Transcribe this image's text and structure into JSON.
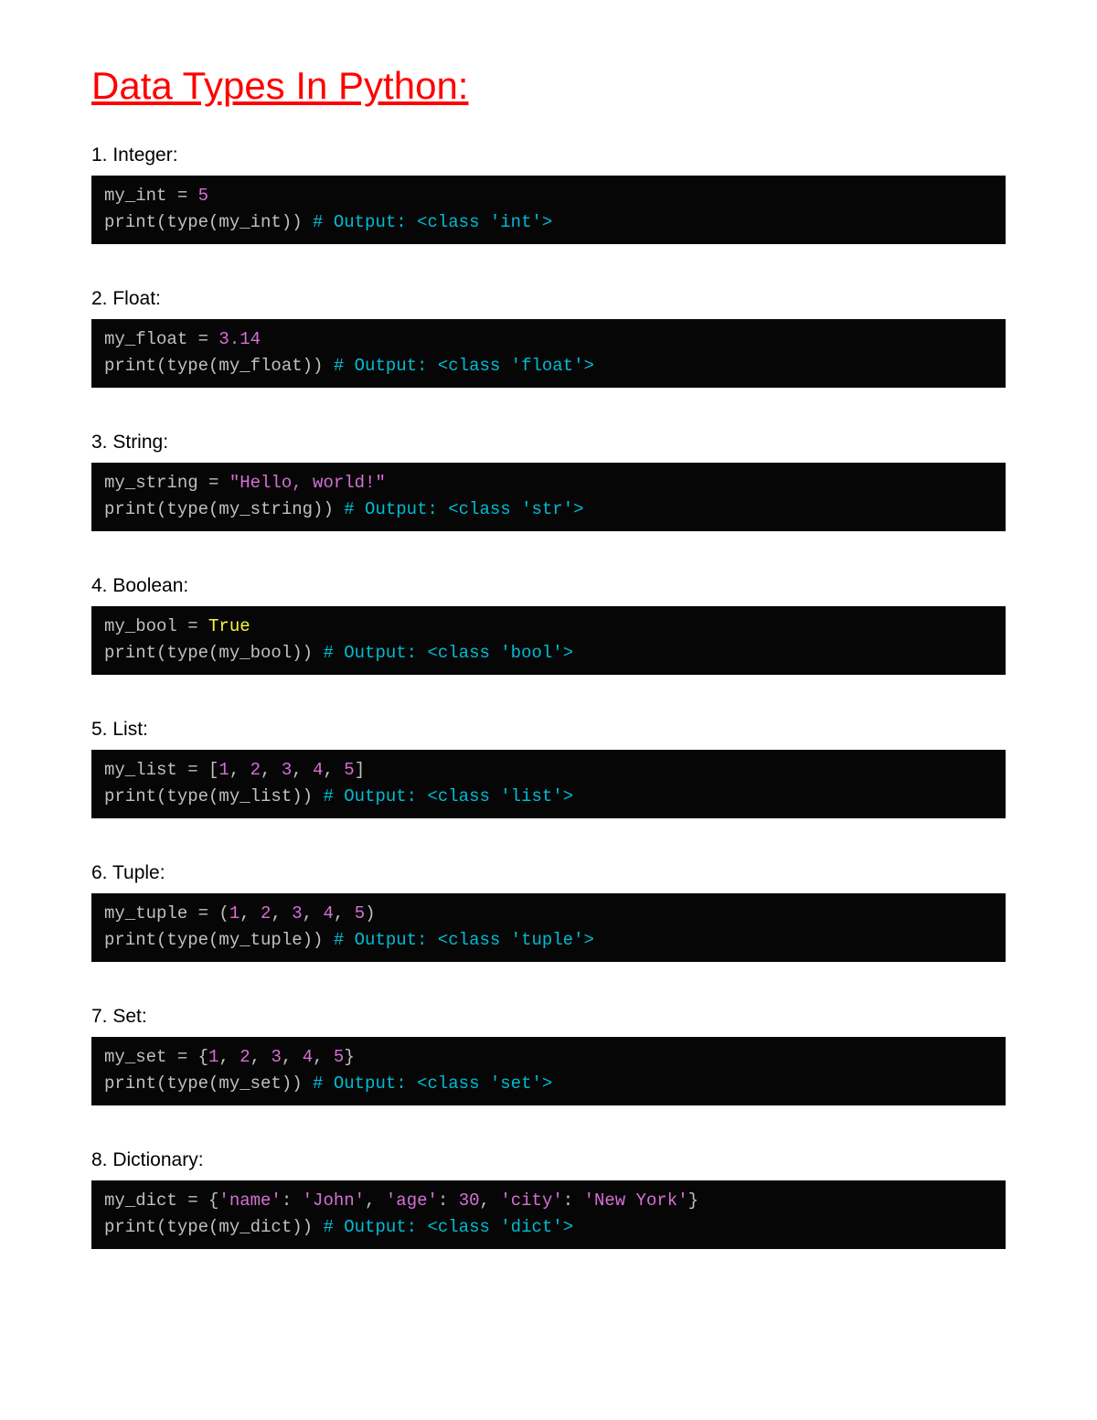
{
  "title": "Data Types In Python:",
  "sections": [
    {
      "heading": "1. Integer:",
      "code_html": "<span class=\"t-default\">my_int = </span><span class=\"t-num\">5</span>\n<span class=\"t-default\">print(type(my_int)) </span><span class=\"t-comment\"># Output: &lt;class 'int'&gt;</span>"
    },
    {
      "heading": "2. Float:",
      "code_html": "<span class=\"t-default\">my_float = </span><span class=\"t-num\">3.14</span>\n<span class=\"t-default\">print(type(my_float)) </span><span class=\"t-comment\"># Output: &lt;class 'float'&gt;</span>"
    },
    {
      "heading": "3. String:",
      "code_html": "<span class=\"t-default\">my_string = </span><span class=\"t-str\">\"Hello, world!\"</span>\n<span class=\"t-default\">print(type(my_string)) </span><span class=\"t-comment\"># Output: &lt;class 'str'&gt;</span>"
    },
    {
      "heading": "4. Boolean:",
      "code_html": "<span class=\"t-default\">my_bool = </span><span class=\"t-bool\">True</span>\n<span class=\"t-default\">print(type(my_bool)) </span><span class=\"t-comment\"># Output: &lt;class 'bool'&gt;</span>"
    },
    {
      "heading": "5. List:",
      "code_html": "<span class=\"t-default\">my_list = [</span><span class=\"t-num\">1</span><span class=\"t-default\">, </span><span class=\"t-num\">2</span><span class=\"t-default\">, </span><span class=\"t-num\">3</span><span class=\"t-default\">, </span><span class=\"t-num\">4</span><span class=\"t-default\">, </span><span class=\"t-num\">5</span><span class=\"t-default\">]</span>\n<span class=\"t-default\">print(type(my_list)) </span><span class=\"t-comment\"># Output: &lt;class 'list'&gt;</span>"
    },
    {
      "heading": "6. Tuple:",
      "code_html": "<span class=\"t-default\">my_tuple = (</span><span class=\"t-num\">1</span><span class=\"t-default\">, </span><span class=\"t-num\">2</span><span class=\"t-default\">, </span><span class=\"t-num\">3</span><span class=\"t-default\">, </span><span class=\"t-num\">4</span><span class=\"t-default\">, </span><span class=\"t-num\">5</span><span class=\"t-default\">)</span>\n<span class=\"t-default\">print(type(my_tuple)) </span><span class=\"t-comment\"># Output: &lt;class 'tuple'&gt;</span>"
    },
    {
      "heading": "7. Set:",
      "code_html": "<span class=\"t-default\">my_set = {</span><span class=\"t-num\">1</span><span class=\"t-default\">, </span><span class=\"t-num\">2</span><span class=\"t-default\">, </span><span class=\"t-num\">3</span><span class=\"t-default\">, </span><span class=\"t-num\">4</span><span class=\"t-default\">, </span><span class=\"t-num\">5</span><span class=\"t-default\">}</span>\n<span class=\"t-default\">print(type(my_set)) </span><span class=\"t-comment\"># Output: &lt;class 'set'&gt;</span>"
    },
    {
      "heading": "8. Dictionary:",
      "code_html": "<span class=\"t-default\">my_dict = {</span><span class=\"t-str\">'name'</span><span class=\"t-default\">: </span><span class=\"t-str\">'John'</span><span class=\"t-default\">, </span><span class=\"t-str\">'age'</span><span class=\"t-default\">: </span><span class=\"t-num\">30</span><span class=\"t-default\">, </span><span class=\"t-str\">'city'</span><span class=\"t-default\">: </span><span class=\"t-str\">'New York'</span><span class=\"t-default\">}</span>\n<span class=\"t-default\">print(type(my_dict)) </span><span class=\"t-comment\"># Output: &lt;class 'dict'&gt;</span>"
    }
  ]
}
